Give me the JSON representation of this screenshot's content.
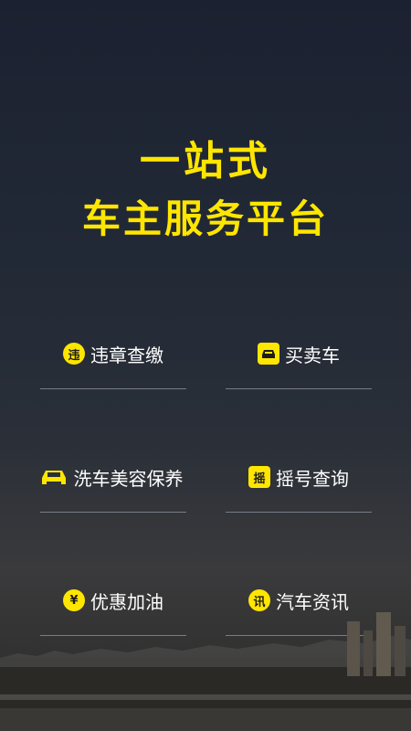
{
  "headline": {
    "line1": "一站式",
    "line2": "车主服务平台"
  },
  "colors": {
    "accent": "#ffe600"
  },
  "services": [
    {
      "label": "违章查缴",
      "icon": "violation-icon",
      "icon_char": "违"
    },
    {
      "label": "买卖车",
      "icon": "buy-sell-car-icon",
      "icon_char": ""
    },
    {
      "label": "洗车美容保养",
      "icon": "car-wash-icon",
      "icon_char": ""
    },
    {
      "label": "摇号查询",
      "icon": "lottery-query-icon",
      "icon_char": "摇"
    },
    {
      "label": "优惠加油",
      "icon": "fuel-discount-icon",
      "icon_char": "¥"
    },
    {
      "label": "汽车资讯",
      "icon": "car-news-icon",
      "icon_char": "讯"
    }
  ]
}
